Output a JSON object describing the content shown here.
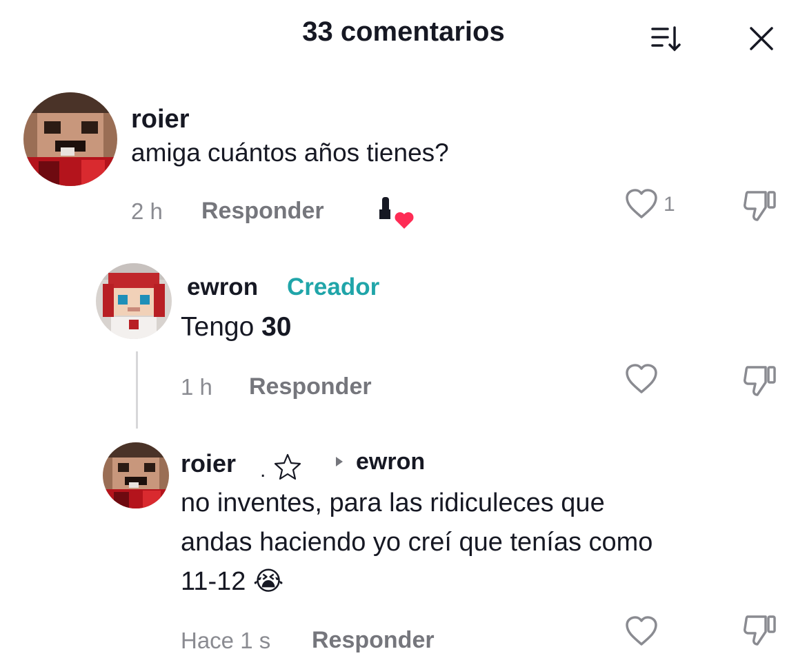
{
  "header": {
    "title": "33 comentarios",
    "sort_icon": "sort-icon",
    "close_icon": "close-icon"
  },
  "comments": [
    {
      "username": "roier",
      "text": "amiga cuántos años tienes?",
      "time": "2 h",
      "reply_label": "Responder",
      "likes": "1",
      "icons": [
        "heart-icon",
        "dislike-icon",
        "creator-liked-badge-icon"
      ]
    },
    {
      "username": "ewron",
      "badge": "Creador",
      "text_prefix": "Tengo ",
      "text_emph": "30",
      "time": "1 h",
      "reply_label": "Responder",
      "icons": [
        "heart-icon",
        "dislike-icon"
      ]
    },
    {
      "username": "roier",
      "punct": ".",
      "reply_to": "ewron",
      "lines": [
        "no inventes, para las ridiculeces que",
        "andas haciendo yo creí que tenías como",
        "11-12 😭"
      ],
      "time": "Hace 1 s",
      "reply_label": "Responder",
      "icons": [
        "star-icon",
        "reply-arrow-icon",
        "heart-icon",
        "dislike-icon"
      ]
    }
  ],
  "colors": {
    "creator": "#20a5a9",
    "meta": "#8a8b91",
    "heart_badge": "#fe2c55",
    "text": "#161823"
  }
}
